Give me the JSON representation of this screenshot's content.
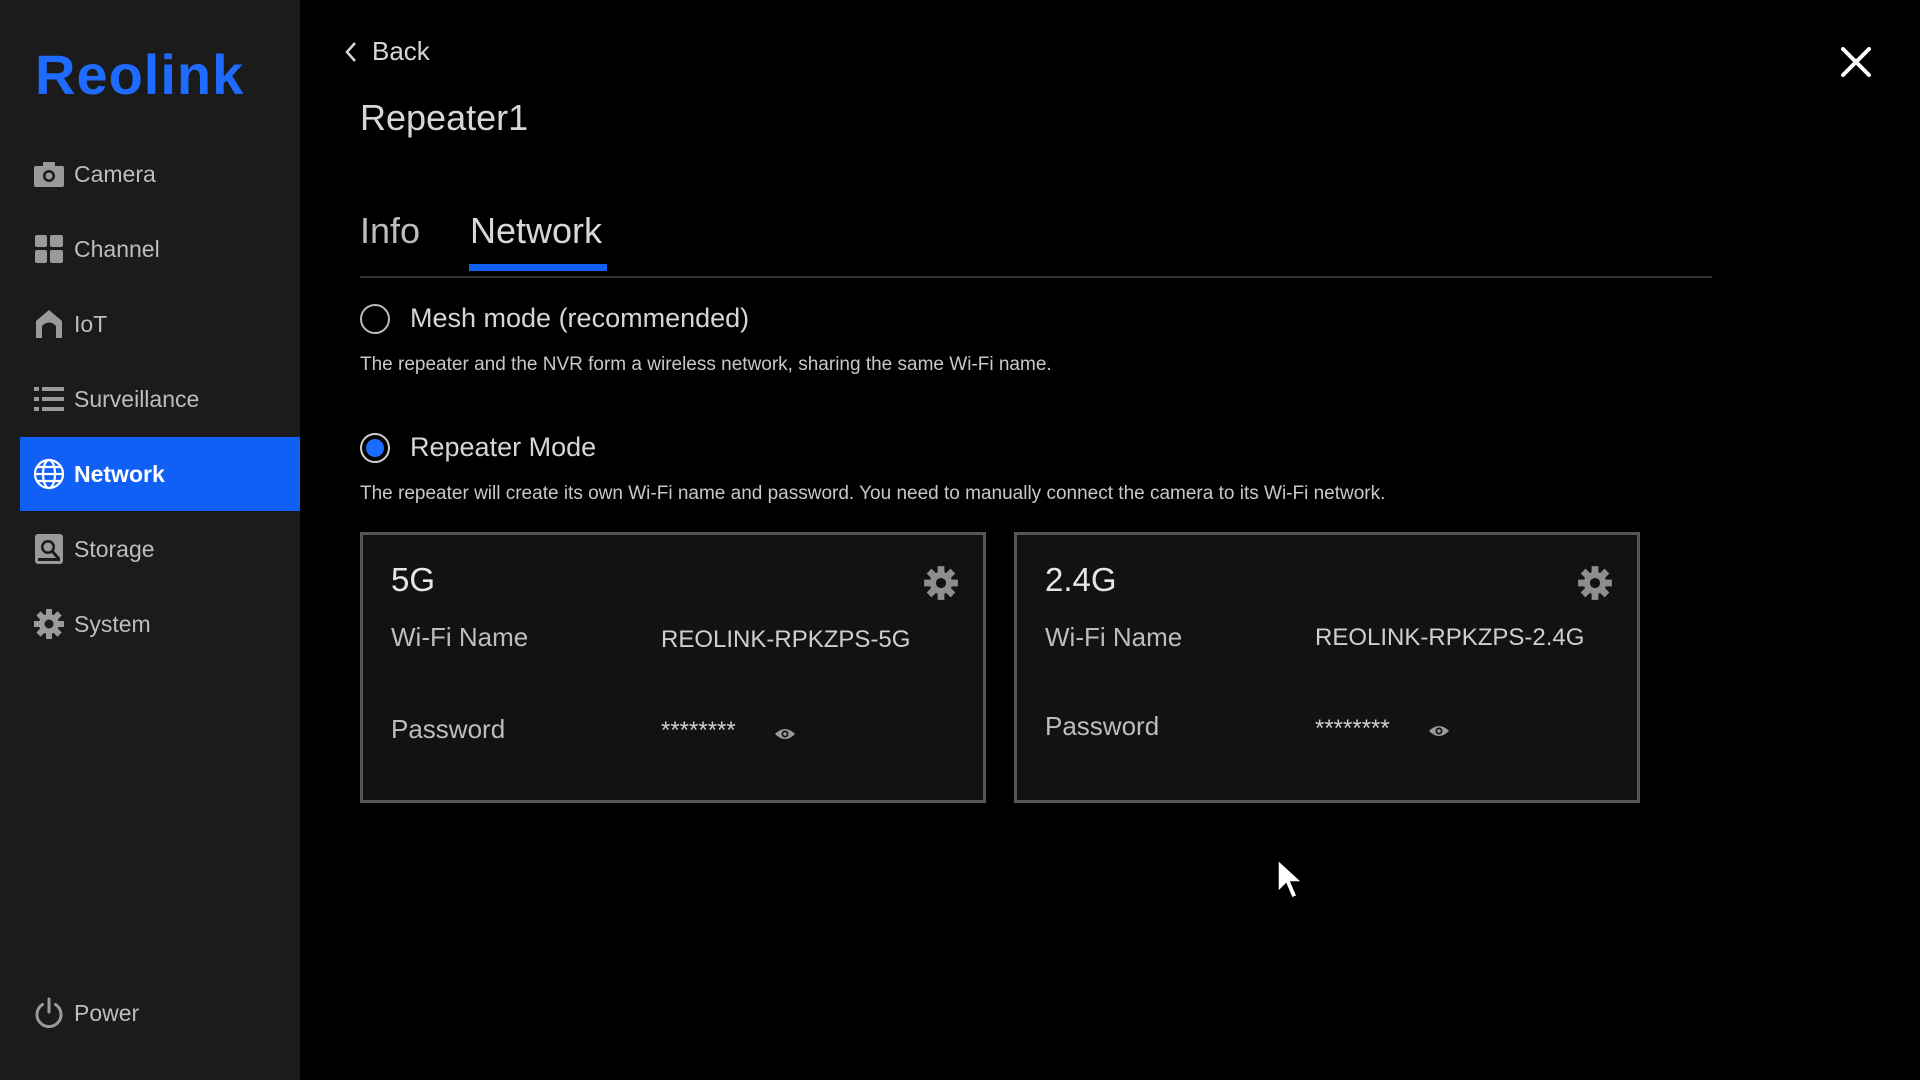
{
  "app": {
    "logo": "Reolink",
    "accent": "#1160f5"
  },
  "sidebar": {
    "items": [
      {
        "label": "Camera",
        "icon": "camera-icon"
      },
      {
        "label": "Channel",
        "icon": "grid-icon"
      },
      {
        "label": "IoT",
        "icon": "house-icon"
      },
      {
        "label": "Surveillance",
        "icon": "list-icon"
      },
      {
        "label": "Network",
        "icon": "globe-icon",
        "active": true
      },
      {
        "label": "Storage",
        "icon": "storage-icon"
      },
      {
        "label": "System",
        "icon": "gear-icon"
      }
    ],
    "power": {
      "label": "Power",
      "icon": "power-icon"
    }
  },
  "header": {
    "back_label": "Back",
    "title": "Repeater1"
  },
  "tabs": [
    {
      "label": "Info"
    },
    {
      "label": "Network",
      "active": true
    }
  ],
  "modes": {
    "mesh": {
      "label": "Mesh mode (recommended)",
      "description": "The repeater and the NVR form a wireless network, sharing the same Wi-Fi name.",
      "selected": false
    },
    "repeater": {
      "label": "Repeater Mode",
      "description": "The repeater will create its own Wi-Fi name and password. You need to manually connect the camera to its Wi-Fi network.",
      "selected": true
    }
  },
  "bands": [
    {
      "band": "5G",
      "wifi_name_label": "Wi-Fi Name",
      "wifi_name": "REOLINK-RPKZPS-5G",
      "password_label": "Password",
      "password": "********"
    },
    {
      "band": "2.4G",
      "wifi_name_label": "Wi-Fi Name",
      "wifi_name": "REOLINK-RPKZPS-2.4G",
      "password_label": "Password",
      "password": "********"
    }
  ]
}
